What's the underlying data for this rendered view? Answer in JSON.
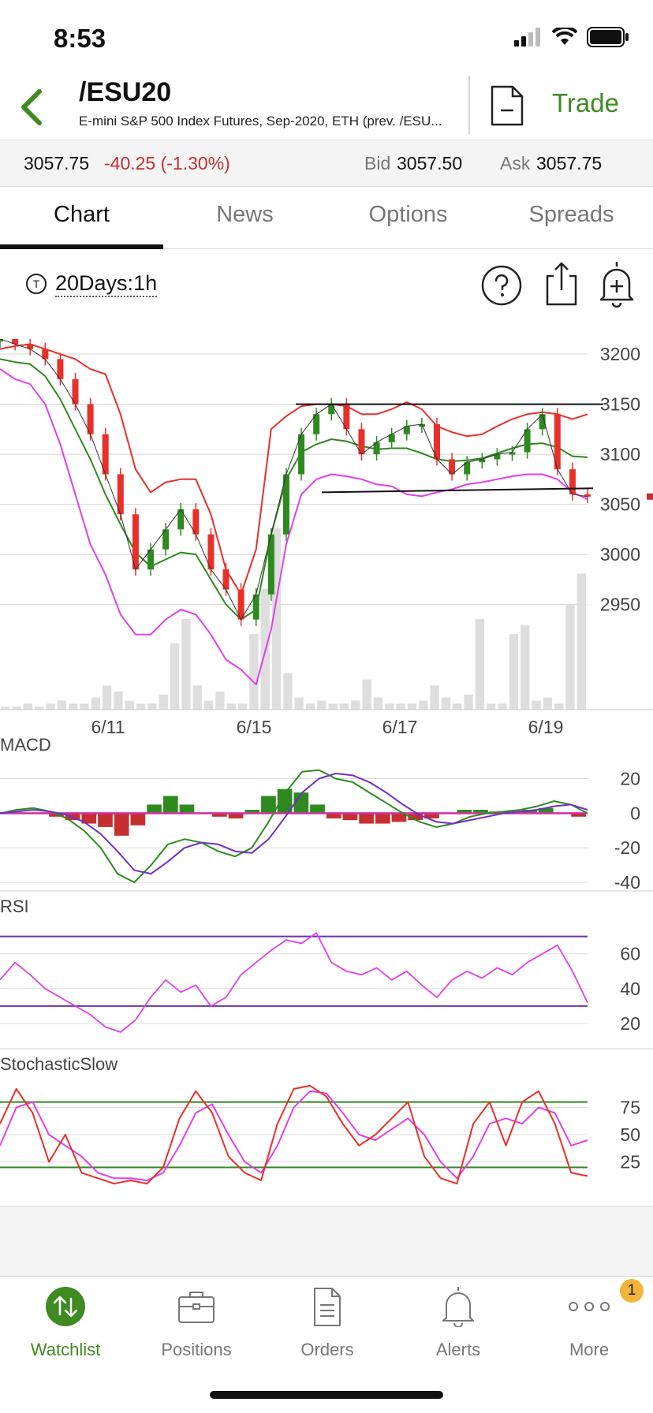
{
  "status": {
    "time": "8:53"
  },
  "header": {
    "symbol": "/ESU20",
    "description": "E-mini S&P 500 Index Futures, Sep-2020, ETH (prev. /ESU...",
    "trade_label": "Trade"
  },
  "quote": {
    "last": "3057.75",
    "change": "-40.25 (-1.30%)",
    "bid_label": "Bid",
    "bid": "3057.50",
    "ask_label": "Ask",
    "ask": "3057.75"
  },
  "tabs": [
    {
      "label": "Chart",
      "active": true
    },
    {
      "label": "News"
    },
    {
      "label": "Options"
    },
    {
      "label": "Spreads"
    }
  ],
  "toolbar": {
    "period_icon_letter": "T",
    "period": "20Days:1h"
  },
  "chart_data": [
    {
      "type": "line",
      "name": "price",
      "x_ticks": [
        "6/11",
        "6/15",
        "6/17",
        "6/19"
      ],
      "y_ticks": [
        3200,
        3150,
        3100,
        3050,
        3000,
        2950
      ],
      "ylim": [
        2845,
        3215
      ],
      "price_series": [
        3215,
        3210,
        3205,
        3195,
        3175,
        3150,
        3120,
        3080,
        3040,
        2985,
        3005,
        3025,
        3045,
        3020,
        2985,
        2965,
        2935,
        2960,
        3020,
        3080,
        3120,
        3140,
        3150,
        3125,
        3100,
        3112,
        3120,
        3128,
        3130,
        3095,
        3080,
        3092,
        3095,
        3100,
        3102,
        3125,
        3140,
        3085,
        3060,
        3057.75
      ],
      "upper_band": [
        3205,
        3208,
        3210,
        3205,
        3200,
        3195,
        3185,
        3180,
        3140,
        3085,
        3062,
        3072,
        3075,
        3075,
        3040,
        2985,
        2960,
        3005,
        3125,
        3138,
        3148,
        3150,
        3150,
        3148,
        3140,
        3140,
        3145,
        3152,
        3145,
        3128,
        3122,
        3118,
        3120,
        3128,
        3135,
        3140,
        3142,
        3140,
        3135,
        3140
      ],
      "lower_band": [
        3185,
        3175,
        3170,
        3150,
        3110,
        3060,
        3010,
        2980,
        2940,
        2920,
        2920,
        2935,
        2945,
        2940,
        2920,
        2895,
        2885,
        2870,
        2925,
        3010,
        3060,
        3075,
        3080,
        3078,
        3075,
        3070,
        3068,
        3060,
        3058,
        3062,
        3065,
        3070,
        3072,
        3075,
        3078,
        3080,
        3080,
        3075,
        3062,
        3055
      ],
      "middle_band": [
        3195,
        3192,
        3190,
        3178,
        3155,
        3125,
        3095,
        3060,
        3030,
        3002,
        2988,
        2995,
        3002,
        3000,
        2975,
        2950,
        2935,
        2945,
        3020,
        3075,
        3102,
        3110,
        3115,
        3113,
        3108,
        3105,
        3106,
        3106,
        3101,
        3095,
        3093,
        3094,
        3096,
        3101,
        3106,
        3110,
        3111,
        3107,
        3098,
        3097
      ],
      "resistance_line": [
        3150,
        3150
      ],
      "support_line": [
        3062,
        3066
      ],
      "volume": [
        1,
        1,
        2,
        1,
        2,
        3,
        2,
        2,
        4,
        8,
        6,
        3,
        2,
        2,
        5,
        22,
        30,
        8,
        3,
        6,
        2,
        2,
        25,
        40,
        60,
        12,
        4,
        2,
        3,
        2,
        2,
        3,
        10,
        4,
        2,
        2,
        2,
        3,
        8,
        4,
        2,
        5,
        30,
        2,
        2,
        25,
        28,
        3,
        4,
        2,
        35,
        45
      ]
    },
    {
      "type": "bar",
      "name": "MACD",
      "y_ticks": [
        20,
        0,
        -20,
        -40
      ],
      "ylim": [
        -45,
        28
      ],
      "macd_line": [
        0,
        2,
        3,
        1,
        -3,
        -10,
        -20,
        -35,
        -40,
        -30,
        -18,
        -15,
        -17,
        -22,
        -25,
        -20,
        -5,
        12,
        24,
        25,
        20,
        18,
        12,
        6,
        0,
        -5,
        -8,
        -6,
        -2,
        0,
        1,
        2,
        4,
        7,
        5,
        0
      ],
      "signal_line": [
        0,
        1,
        2,
        1,
        -1,
        -5,
        -12,
        -22,
        -33,
        -35,
        -28,
        -20,
        -17,
        -18,
        -22,
        -23,
        -15,
        -2,
        12,
        20,
        23,
        22,
        18,
        12,
        5,
        -1,
        -5,
        -6,
        -4,
        -2,
        0,
        1,
        2,
        4,
        5,
        2
      ],
      "histogram": [
        0,
        0,
        0,
        -2,
        -4,
        -6,
        -8,
        -13,
        -7,
        5,
        10,
        5,
        0,
        -2,
        -3,
        2,
        10,
        14,
        12,
        5,
        -3,
        -4,
        -6,
        -6,
        -5,
        -4,
        -3,
        0,
        2,
        2,
        1,
        1,
        2,
        3,
        0,
        -2
      ]
    },
    {
      "type": "line",
      "name": "RSI",
      "y_ticks": [
        60,
        40,
        20
      ],
      "ylim": [
        10,
        78
      ],
      "upper_level": 70,
      "lower_level": 30,
      "rsi": [
        45,
        55,
        48,
        40,
        35,
        30,
        25,
        18,
        15,
        22,
        35,
        45,
        38,
        42,
        30,
        35,
        48,
        55,
        62,
        68,
        66,
        72,
        55,
        50,
        48,
        52,
        45,
        50,
        42,
        35,
        45,
        50,
        46,
        52,
        48,
        55,
        60,
        65,
        50,
        32
      ]
    },
    {
      "type": "line",
      "name": "StochasticSlow",
      "y_ticks": [
        75,
        50,
        25
      ],
      "ylim": [
        -5,
        100
      ],
      "upper_level": 80,
      "lower_level": 20,
      "k_line": [
        60,
        92,
        70,
        25,
        50,
        15,
        10,
        5,
        8,
        5,
        20,
        65,
        90,
        70,
        30,
        15,
        8,
        60,
        92,
        95,
        85,
        60,
        40,
        50,
        65,
        80,
        30,
        10,
        5,
        60,
        80,
        40,
        80,
        90,
        60,
        15,
        12
      ],
      "d_line": [
        40,
        75,
        80,
        50,
        40,
        30,
        15,
        10,
        10,
        8,
        15,
        40,
        70,
        78,
        50,
        25,
        15,
        40,
        75,
        90,
        88,
        70,
        50,
        45,
        55,
        65,
        50,
        25,
        10,
        30,
        60,
        65,
        60,
        75,
        70,
        40,
        45
      ]
    }
  ],
  "panels": {
    "macd_title": "MACD",
    "rsi_title": "RSI",
    "stoch_title": "StochasticSlow"
  },
  "colors": {
    "accent": "#3f8b22",
    "down": "#c62f2f",
    "band": "#e8302a",
    "middle": "#2e8a1f",
    "lower": "#e040e8",
    "volume": "#dedede",
    "rsi": "#e040e8",
    "level": "#7030a8"
  },
  "tabbar": [
    {
      "label": "Watchlist",
      "icon": "watchlist-icon",
      "active": true
    },
    {
      "label": "Positions",
      "icon": "briefcase-icon"
    },
    {
      "label": "Orders",
      "icon": "orders-icon"
    },
    {
      "label": "Alerts",
      "icon": "bell-icon"
    },
    {
      "label": "More",
      "icon": "more-icon",
      "badge": "1"
    }
  ]
}
